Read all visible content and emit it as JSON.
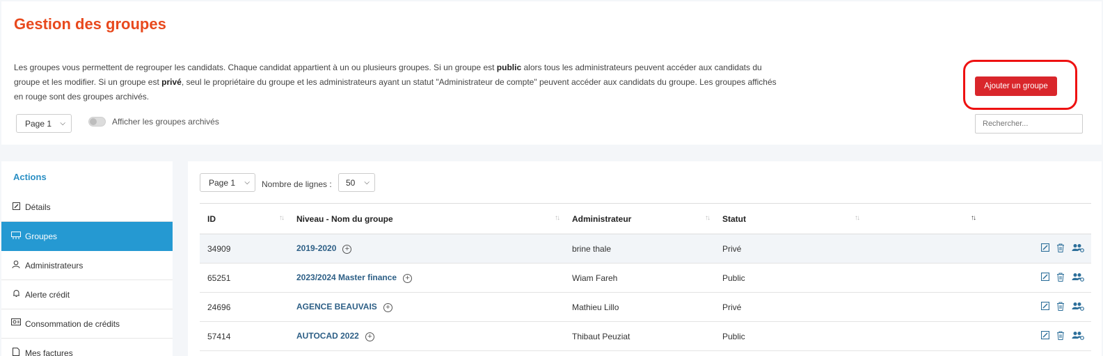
{
  "header": {
    "title": "Gestion des groupes",
    "desc_1": "Les groupes vous permettent de regrouper les candidats. Chaque candidat appartient à un ou plusieurs groupes. Si un groupe est ",
    "desc_bold_1": "public",
    "desc_2": " alors tous les administrateurs peuvent accéder aux candidats du groupe et les modifier. Si un groupe est ",
    "desc_bold_2": "privé",
    "desc_3": ", seul le propriétaire du groupe et les administrateurs ayant un statut \"Administrateur de compte\" peuvent accéder aux candidats du groupe. Les groupes affichés en rouge sont des groupes archivés.",
    "page_select": "Page 1",
    "archived_toggle_label": "Afficher les groupes archivés",
    "add_button": "Ajouter un groupe",
    "search_placeholder": "Rechercher..."
  },
  "sidebar": {
    "title": "Actions",
    "items": [
      {
        "label": "Détails",
        "icon": "edit-icon"
      },
      {
        "label": "Groupes",
        "icon": "groups-icon"
      },
      {
        "label": "Administrateurs",
        "icon": "admin-icon"
      },
      {
        "label": "Alerte crédit",
        "icon": "bell-icon"
      },
      {
        "label": "Consommation de crédits",
        "icon": "credits-icon"
      },
      {
        "label": "Mes factures",
        "icon": "invoice-icon"
      }
    ]
  },
  "table_controls": {
    "page_select": "Page 1",
    "lines_label": "Nombre de lignes :",
    "lines_value": "50"
  },
  "table": {
    "headers": [
      "ID",
      "Niveau - Nom du groupe",
      "Administrateur",
      "Statut"
    ],
    "rows": [
      {
        "id": "34909",
        "name": "2019-2020",
        "admin": "brine thale",
        "status": "Privé"
      },
      {
        "id": "65251",
        "name": "2023/2024 Master finance",
        "admin": "Wiam Fareh",
        "status": "Public"
      },
      {
        "id": "24696",
        "name": "AGENCE BEAUVAIS",
        "admin": "Mathieu Lillo",
        "status": "Privé"
      },
      {
        "id": "57414",
        "name": "AUTOCAD 2022",
        "admin": "Thibaut Peuziat",
        "status": "Public"
      }
    ]
  },
  "colors": {
    "accent": "#e8491d",
    "primary": "#2599d2",
    "danger": "#d9262b"
  }
}
